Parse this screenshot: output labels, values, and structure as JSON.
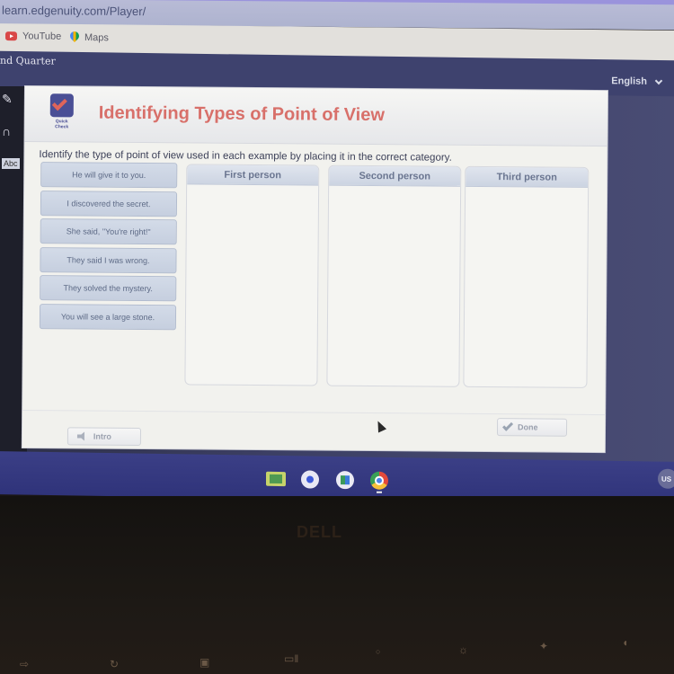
{
  "browser": {
    "url": "learn.edgenuity.com/Player/",
    "bookmarks": [
      {
        "label": "YouTube",
        "icon": "youtube-icon"
      },
      {
        "label": "Maps",
        "icon": "maps-icon"
      }
    ]
  },
  "app_header": {
    "course_title": "nd Quarter",
    "language": "English"
  },
  "left_rail": {
    "icons": [
      "pencil-icon",
      "headphones-icon",
      "dictionary-icon"
    ],
    "dictionary_label": "Abc"
  },
  "activity": {
    "badge_label": "Quick Check",
    "title": "Identifying Types of Point of View",
    "instructions": "Identify the type of point of view used in each example by placing it in the correct category.",
    "tiles": [
      "He will give it to you.",
      "I discovered the secret.",
      "She said, \"You're right!\"",
      "They said I was wrong.",
      "They solved the mystery.",
      "You will see a large stone."
    ],
    "categories": [
      {
        "label": "First person",
        "items": []
      },
      {
        "label": "Second person",
        "items": []
      },
      {
        "label": "Third person",
        "items": []
      }
    ],
    "intro_label": "Intro",
    "done_label": "Done"
  },
  "shelf": {
    "apps": [
      "classroom-icon",
      "camera-icon",
      "files-icon",
      "chrome-icon"
    ],
    "input_method": "US"
  },
  "laptop": {
    "brand": "DELL"
  }
}
